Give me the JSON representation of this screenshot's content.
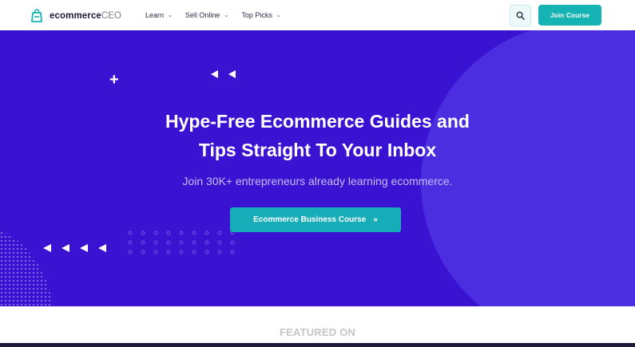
{
  "header": {
    "logo": {
      "prefix": "ecommerce",
      "suffix": "CEO"
    },
    "nav": [
      {
        "label": "Learn"
      },
      {
        "label": "Sell Online"
      },
      {
        "label": "Top Picks"
      }
    ],
    "search_icon": "search-icon",
    "join_label": "Join Course"
  },
  "hero": {
    "title_line1": "Hype-Free Ecommerce Guides and",
    "title_line2": "Tips Straight To Your Inbox",
    "subtitle": "Join 30K+ entrepreneurs already learning ecommerce.",
    "cta_label": "Ecommerce Business Course",
    "cta_arrow": "»"
  },
  "featured": {
    "label": "FEATURED ON"
  },
  "colors": {
    "hero_bg": "#3a12d1",
    "hero_circle": "#4a2ee0",
    "accent_teal": "#15b3b4",
    "subtitle": "#c3bdfb",
    "text_dark": "#1b1c3a"
  }
}
